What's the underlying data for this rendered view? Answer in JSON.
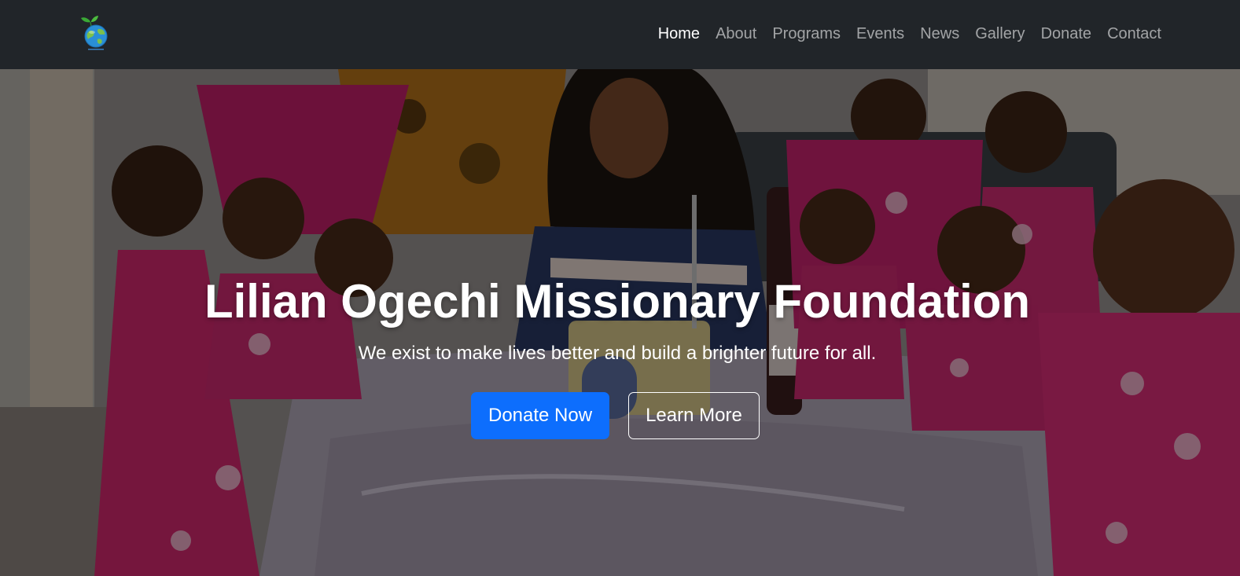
{
  "navbar": {
    "logo": {
      "icon": "globe-seedling-logo",
      "colors": {
        "leaf": "#3aa935",
        "globe": "#2a8fd6"
      }
    },
    "links": [
      {
        "label": "Home",
        "active": true
      },
      {
        "label": "About"
      },
      {
        "label": "Programs"
      },
      {
        "label": "Events"
      },
      {
        "label": "News"
      },
      {
        "label": "Gallery"
      },
      {
        "label": "Donate"
      },
      {
        "label": "Contact"
      }
    ]
  },
  "hero": {
    "title": "Lilian Ogechi Missionary Foundation",
    "subtitle": "We exist to make lives better and build a brighter future for all.",
    "buttons": {
      "primary": "Donate Now",
      "secondary": "Learn More"
    },
    "background": "photo-children-celebration-with-cake",
    "overlay": "dark"
  },
  "colors": {
    "navbar_bg": "#212529",
    "primary": "#0d6efd",
    "text_light": "#ffffff"
  }
}
